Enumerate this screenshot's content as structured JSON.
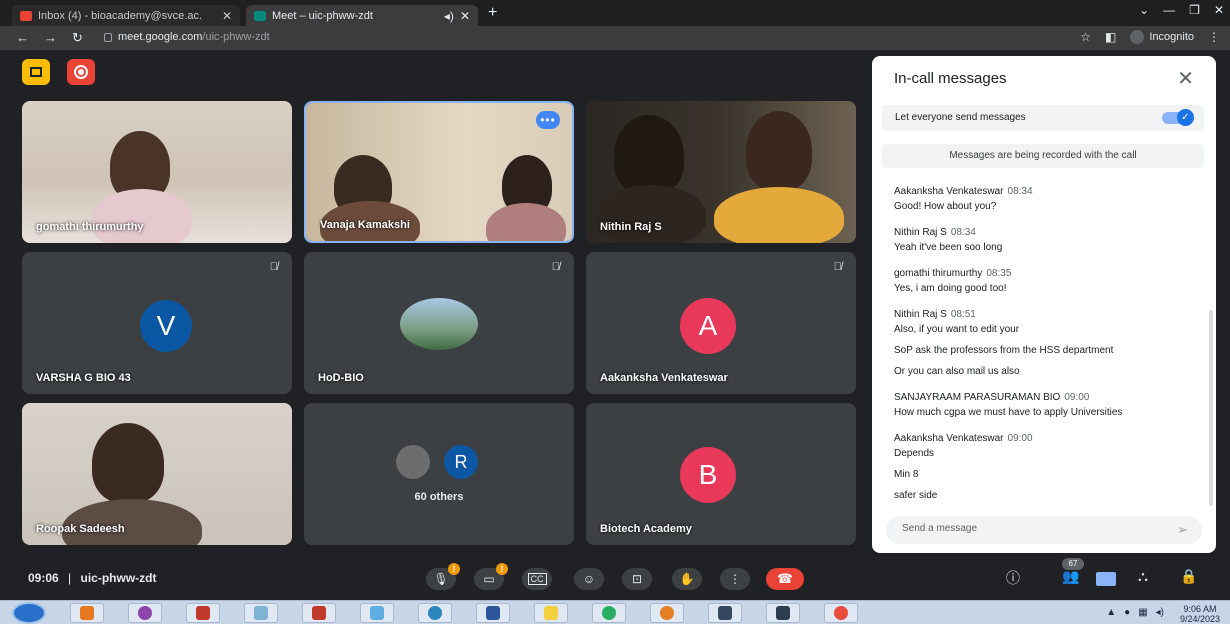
{
  "browser": {
    "tabs": [
      {
        "title": "Inbox (4) - bioacademy@svce.ac.",
        "icon": "gmail-icon",
        "color": "#ea4335"
      },
      {
        "title": "Meet – uic-phww-zdt",
        "icon": "meet-icon",
        "color": "#00897b"
      }
    ],
    "url_host": "meet.google.com",
    "url_path": "/uic-phww-zdt",
    "incognito_label": "Incognito"
  },
  "tiles": [
    {
      "name": "gomathi thirumurthy"
    },
    {
      "name": "Vanaja Kamakshi"
    },
    {
      "name": "Nithin Raj S"
    },
    {
      "name": "VARSHA G BIO 43",
      "initial": "V",
      "avatar_color": "#0b57a4"
    },
    {
      "name": "HoD-BIO"
    },
    {
      "name": "Aakanksha Venkateswar",
      "initial": "A",
      "avatar_color": "#e8395b"
    },
    {
      "name": "Roopak Sadeesh"
    },
    {
      "others_label": "60 others",
      "initial": "R",
      "avatar_color": "#0b57a4"
    },
    {
      "name": "Biotech Academy",
      "initial": "B",
      "avatar_color": "#e8395b"
    }
  ],
  "chat": {
    "title": "In-call messages",
    "toggle_label": "Let everyone send messages",
    "toggle_on": true,
    "notice": "Messages are being recorded with the call",
    "messages": [
      {
        "sender": "Aakanksha Venkateswar",
        "time": "08:34",
        "lines": [
          "Good! How about you?"
        ]
      },
      {
        "sender": "Nithin Raj S",
        "time": "08:34",
        "lines": [
          "Yeah it've been soo long"
        ]
      },
      {
        "sender": "gomathi thirumurthy",
        "time": "08:35",
        "lines": [
          "Yes, i am doing good too!"
        ]
      },
      {
        "sender": "Nithin Raj S",
        "time": "08:51",
        "lines": [
          "Also, if you want to edit your",
          "SoP ask the professors from the HSS department",
          "Or you can also mail us also"
        ]
      },
      {
        "sender": "SANJAYRAAM PARASURAMAN BIO",
        "time": "09:00",
        "lines": [
          "How much cgpa we must have to apply Universities"
        ]
      },
      {
        "sender": "Aakanksha Venkateswar",
        "time": "09:00",
        "lines": [
          "Depends",
          "Min 8",
          "safer side"
        ]
      }
    ],
    "input_placeholder": "Send a message"
  },
  "bottom": {
    "time": "09:06",
    "separator": "|",
    "meeting_code": "uic-phww-zdt",
    "participants_count": "67"
  },
  "taskbar": {
    "time": "9:06 AM",
    "date": "9/24/2023"
  }
}
